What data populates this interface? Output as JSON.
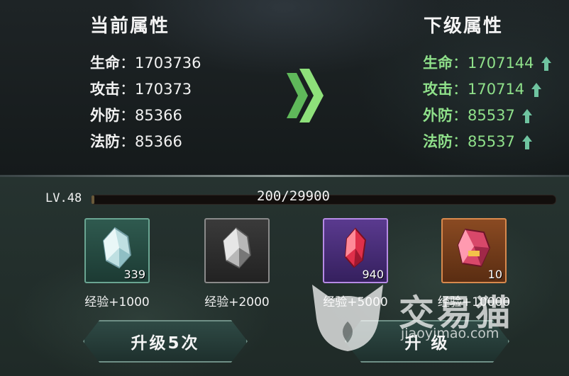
{
  "current": {
    "title": "当前属性",
    "stats": [
      {
        "label": "生命",
        "value": "1703736"
      },
      {
        "label": "攻击",
        "value": "170373"
      },
      {
        "label": "外防",
        "value": "85366"
      },
      {
        "label": "法防",
        "value": "85366"
      }
    ]
  },
  "next": {
    "title": "下级属性",
    "stats": [
      {
        "label": "生命",
        "value": "1707144"
      },
      {
        "label": "攻击",
        "value": "170714"
      },
      {
        "label": "外防",
        "value": "85537"
      },
      {
        "label": "法防",
        "value": "85537"
      }
    ]
  },
  "level": {
    "label": "LV.48",
    "exp_text": "200/29900",
    "progress": 0.0067
  },
  "items": [
    {
      "count": "339",
      "exp": "经验+1000",
      "icon": "pale-crystal-icon"
    },
    {
      "count": "",
      "exp": "经验+2000",
      "icon": "grey-crystal-icon"
    },
    {
      "count": "940",
      "exp": "经验+5000",
      "icon": "red-crystal-icon"
    },
    {
      "count": "10",
      "exp": "经验+10000",
      "icon": "ruby-crystal-icon"
    }
  ],
  "buttons": {
    "upgrade5": "升级5次",
    "upgrade": "升 级"
  },
  "watermark": {
    "text": "交易猫",
    "url": "jiaoyimao.com"
  },
  "colors": {
    "next_stat": "#8fe08a",
    "arrow": "#7ed36c"
  }
}
